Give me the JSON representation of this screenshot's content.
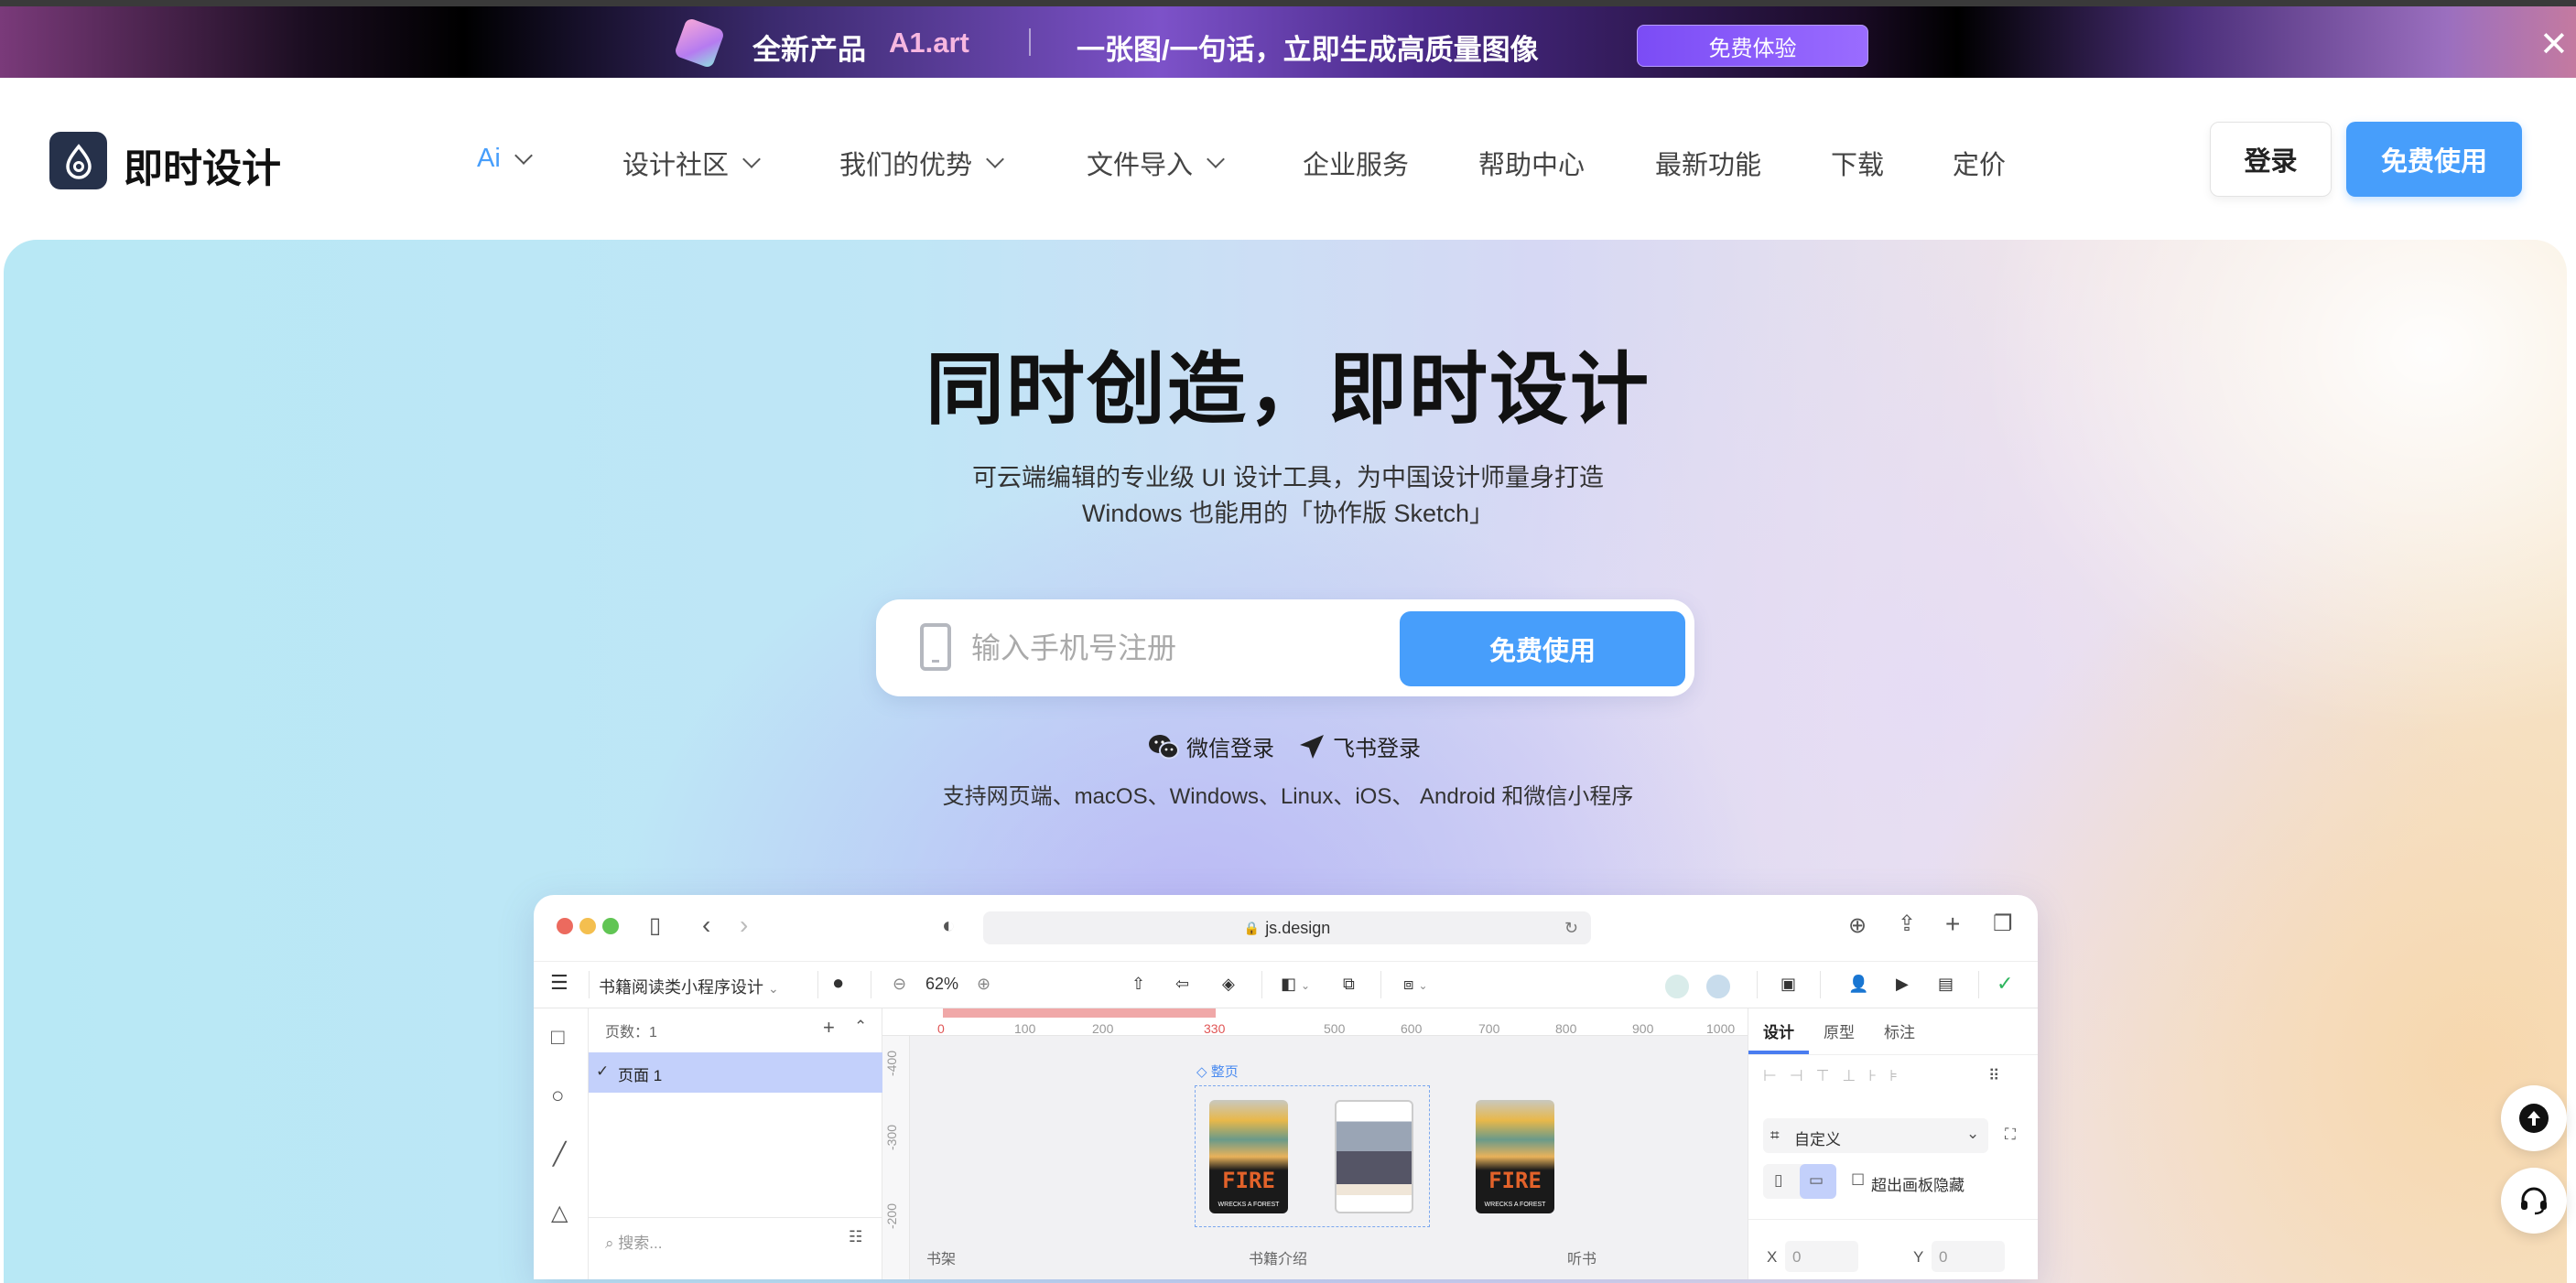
{
  "banner": {
    "product_label": "全新产品",
    "product_name": "A1.art",
    "tagline": "一张图/一句话，立即生成高质量图像",
    "cta": "免费体验",
    "close_icon": "close-icon"
  },
  "nav": {
    "logo_text": "即时设计",
    "items": [
      {
        "label": "Ai",
        "dropdown": true,
        "active": true
      },
      {
        "label": "设计社区",
        "dropdown": true
      },
      {
        "label": "我们的优势",
        "dropdown": true
      },
      {
        "label": "文件导入",
        "dropdown": true
      },
      {
        "label": "企业服务",
        "dropdown": false
      },
      {
        "label": "帮助中心",
        "dropdown": false
      },
      {
        "label": "最新功能",
        "dropdown": false
      },
      {
        "label": "下载",
        "dropdown": false
      },
      {
        "label": "定价",
        "dropdown": false
      }
    ],
    "login": "登录",
    "free_use": "免费使用"
  },
  "hero": {
    "title": "同时创造，即时设计",
    "subtitle_line1": "可云端编辑的专业级 UI 设计工具，为中国设计师量身打造",
    "subtitle_line2": "Windows 也能用的「协作版 Sketch」",
    "phone_placeholder": "输入手机号注册",
    "signup_button": "免费使用",
    "wechat_login": "微信登录",
    "feishu_login": "飞书登录",
    "platforms": "支持网页端、macOS、Windows、Linux、iOS、 Android 和微信小程序"
  },
  "app": {
    "url": "js.design",
    "file_name": "书籍阅读类小程序设计",
    "zoom": "62%",
    "pages_count": "页数：1",
    "pages": [
      "页面 1"
    ],
    "search_placeholder": "搜索...",
    "ruler_x": [
      "0",
      "100",
      "200",
      "330",
      "500",
      "600",
      "700",
      "800",
      "900",
      "1000"
    ],
    "ruler_y": [
      "-400",
      "-300",
      "-200"
    ],
    "frame_label": "整页",
    "poster_title": "FIRE",
    "poster_subtitle": "WRECKS A FOREST",
    "canvas_labels": [
      "书架",
      "书籍介绍",
      "听书"
    ],
    "right_tabs": [
      "设计",
      "原型",
      "标注"
    ],
    "frame_preset": "自定义",
    "clip_content": "超出画板隐藏",
    "x_label": "X",
    "x_value": "0",
    "y_label": "Y",
    "y_value": "0"
  },
  "colors": {
    "primary": "#479efb",
    "nav_active": "#479efb",
    "selection": "#c3d0fb",
    "ruler_highlight": "#f0a8a8"
  }
}
